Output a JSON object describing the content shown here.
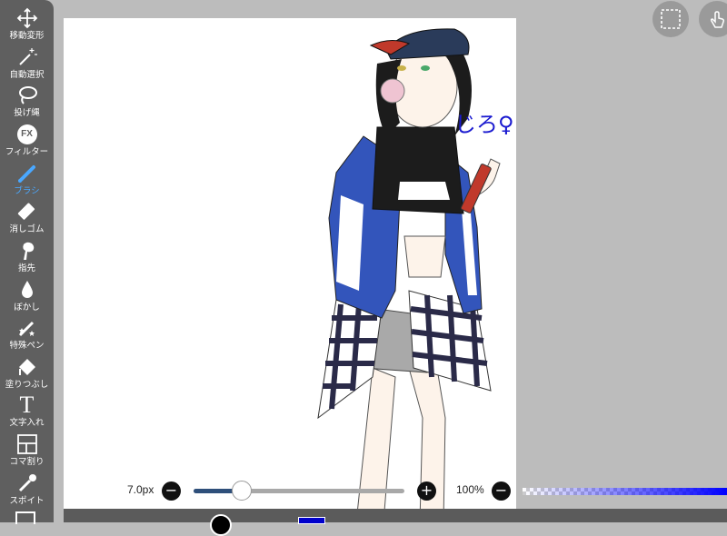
{
  "toolbar": {
    "tools": [
      {
        "label": "移動変形",
        "icon": "move-icon"
      },
      {
        "label": "自動選択",
        "icon": "magic-wand-icon"
      },
      {
        "label": "投げ縄",
        "icon": "lasso-icon"
      },
      {
        "label": "フィルター",
        "icon": "fx-icon",
        "icon_text": "FX"
      },
      {
        "label": "ブラシ",
        "icon": "brush-icon",
        "active": true
      },
      {
        "label": "消しゴム",
        "icon": "eraser-icon"
      },
      {
        "label": "指先",
        "icon": "smudge-icon"
      },
      {
        "label": "ぼかし",
        "icon": "blur-drop-icon"
      },
      {
        "label": "特殊ペン",
        "icon": "special-pen-icon"
      },
      {
        "label": "塗りつぶし",
        "icon": "fill-bucket-icon"
      },
      {
        "label": "文字入れ",
        "icon": "text-icon",
        "icon_text": "T"
      },
      {
        "label": "コマ割り",
        "icon": "panel-divide-icon"
      },
      {
        "label": "スポイト",
        "icon": "eyedropper-icon"
      }
    ]
  },
  "canvas": {
    "handwritten_text": "じろ♀"
  },
  "controls": {
    "brush_size": "7.0px",
    "brush_size_fraction": 0.23,
    "zoom": "100%",
    "minus": "−",
    "plus": "+"
  },
  "colors": {
    "accent": "#4aa8ff",
    "current_color": "#0000cc",
    "toolbar_bg": "#5f5f5f",
    "workspace_bg": "#bcbcbc"
  },
  "top_buttons": [
    {
      "icon": "selection-icon"
    },
    {
      "icon": "touch-gesture-icon"
    }
  ]
}
